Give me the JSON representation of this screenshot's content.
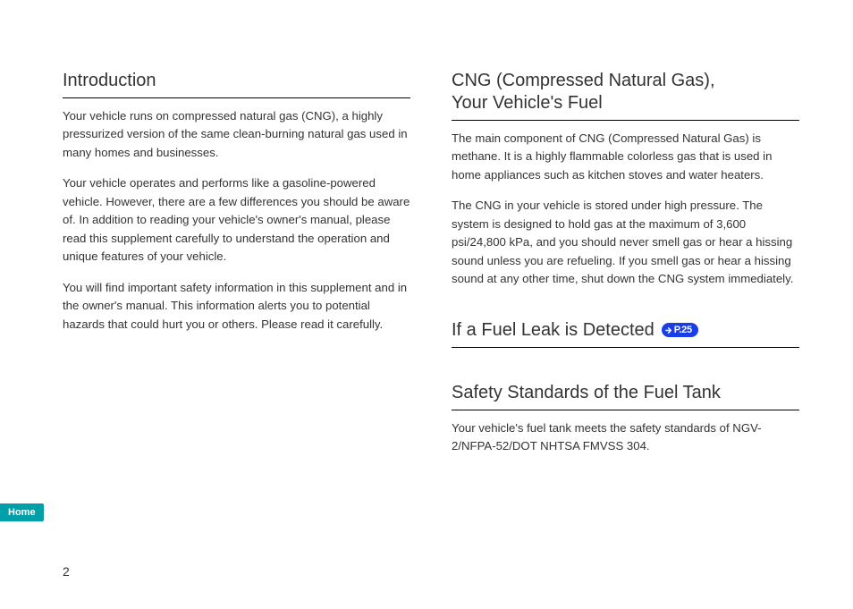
{
  "leftColumn": {
    "heading": "Introduction",
    "p1": "Your  vehicle runs on compressed natural gas (CNG), a highly pressurized version of the same clean-burning natural gas used in many homes and businesses.",
    "p2": "Your vehicle operates and performs like a gasoline-powered vehicle. However, there are a few differences you should be aware of. In addition to reading your vehicle's owner's manual, please read this supplement carefully to understand the operation and unique features of your vehicle.",
    "p3": "You will find important safety information in this supplement and in the owner's manual. This information alerts you to potential hazards that could hurt you or others. Please read it carefully."
  },
  "rightColumn": {
    "cngHeadingLine1": "CNG (Compressed Natural Gas),",
    "cngHeadingLine2": "Your Vehicle's Fuel",
    "cngP1": "The main component of CNG (Compressed Natural Gas) is methane. It is a highly flammable colorless gas that is used in home appliances such as kitchen stoves and water heaters.",
    "cngP2": "The CNG in your vehicle is stored under high pressure. The system is designed to hold gas at the maximum of 3,600 psi/24,800 kPa, and you should never smell gas or hear a hissing sound unless you are refueling. If you smell gas or hear a hissing sound at any other time, shut down the CNG system immediately.",
    "leakHeading": "If a Fuel Leak is Detected",
    "leakBadge": "P.25",
    "safetyHeading": "Safety Standards of the Fuel Tank",
    "safetyP1": "Your vehicle's fuel tank meets the safety standards of NGV-2/NFPA-52/DOT NHTSA FMVSS 304."
  },
  "nav": {
    "homeLabel": "Home"
  },
  "pageNumber": "2"
}
